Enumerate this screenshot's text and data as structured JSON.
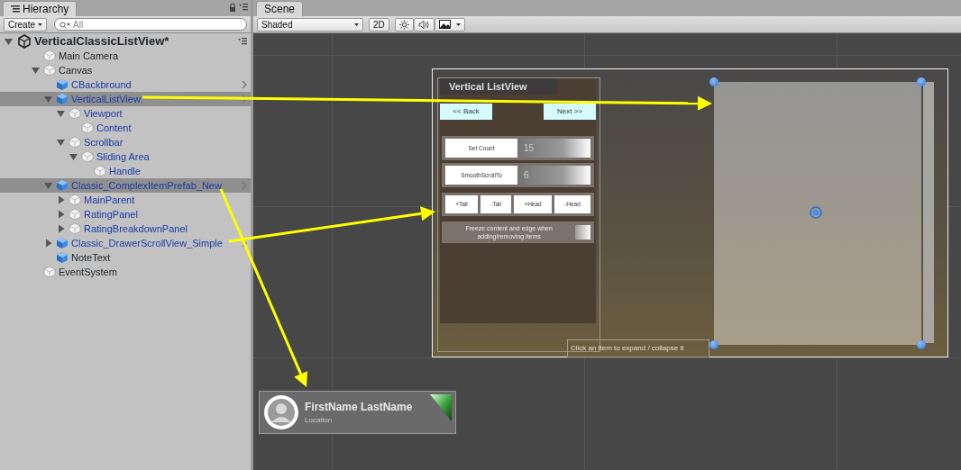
{
  "hierarchy": {
    "tab": "Hierarchy",
    "create": "Create",
    "search": {
      "placeholder": "All"
    },
    "scene": {
      "name": "VerticalClassicListView*",
      "expanded": true,
      "children": [
        {
          "name": "Main Camera",
          "kind": "object",
          "linked": false,
          "selected": false,
          "chevron": false
        },
        {
          "name": "Canvas",
          "kind": "object",
          "linked": false,
          "selected": false,
          "chevron": false,
          "expanded": true,
          "children": [
            {
              "name": "CBackbround",
              "kind": "prefab",
              "linked": true,
              "selected": false,
              "chevron": true
            },
            {
              "name": "VerticalListView",
              "kind": "prefab",
              "linked": true,
              "selected": true,
              "chevron": true,
              "expanded": true,
              "children": [
                {
                  "name": "Viewport",
                  "kind": "object",
                  "linked": true,
                  "selected": false,
                  "chevron": false,
                  "expanded": true,
                  "children": [
                    {
                      "name": "Content",
                      "kind": "object",
                      "linked": true,
                      "selected": false,
                      "chevron": false
                    }
                  ]
                },
                {
                  "name": "Scrollbar",
                  "kind": "object",
                  "linked": true,
                  "selected": false,
                  "chevron": false,
                  "expanded": true,
                  "children": [
                    {
                      "name": "Sliding Area",
                      "kind": "object",
                      "linked": true,
                      "selected": false,
                      "chevron": false,
                      "expanded": true,
                      "children": [
                        {
                          "name": "Handle",
                          "kind": "object",
                          "linked": true,
                          "selected": false,
                          "chevron": false
                        }
                      ]
                    }
                  ]
                }
              ]
            },
            {
              "name": "Classic_ComplexItemPrefab_New",
              "kind": "prefab",
              "linked": true,
              "selected": true,
              "chevron": true,
              "expanded": true,
              "children": [
                {
                  "name": "MainParent",
                  "kind": "object",
                  "linked": true,
                  "selected": false,
                  "chevron": false,
                  "expanded": false
                },
                {
                  "name": "RatingPanel",
                  "kind": "object",
                  "linked": true,
                  "selected": false,
                  "chevron": false,
                  "expanded": false
                },
                {
                  "name": "RatingBreakdownPanel",
                  "kind": "object",
                  "linked": true,
                  "selected": false,
                  "chevron": false,
                  "expanded": false
                }
              ]
            },
            {
              "name": "Classic_DrawerScrollView_Simple",
              "kind": "prefab",
              "linked": true,
              "selected": false,
              "chevron": true,
              "expanded": false
            },
            {
              "name": "NoteText",
              "kind": "prefab",
              "linked": false,
              "selected": false,
              "chevron": false
            }
          ]
        },
        {
          "name": "EventSystem",
          "kind": "object",
          "linked": false,
          "selected": false,
          "chevron": false
        }
      ]
    }
  },
  "scene_view": {
    "tab": "Scene",
    "draw_mode": "Shaded",
    "mode_2d": "2D",
    "list_preview": {
      "title": "Vertical ListView",
      "back": "<< Back",
      "next": "Next >>",
      "fields": [
        {
          "label": "Set Count",
          "value": "15"
        },
        {
          "label": "SmoothScrollTo",
          "value": "6"
        }
      ],
      "buttons": [
        "+Tail",
        "-Tail",
        "+Head",
        "-Head"
      ],
      "freeze": {
        "label": "Freeze content and edge when adding/removing items",
        "checked": false
      }
    },
    "note": "Click an item to expand / collapse it",
    "item_prefab": {
      "name": "FirstName LastName",
      "location": "Location"
    }
  }
}
